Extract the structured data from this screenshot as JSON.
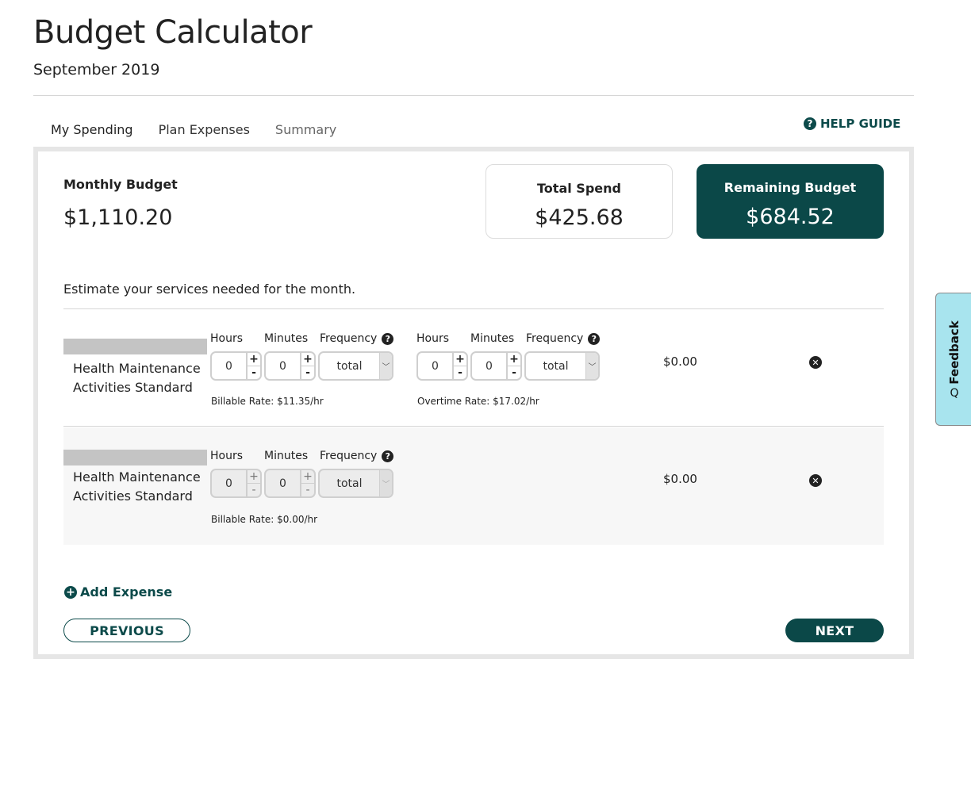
{
  "header": {
    "title": "Budget Calculator",
    "subtitle": "September 2019"
  },
  "tabs": [
    {
      "label": "My Spending",
      "active": false
    },
    {
      "label": "Plan Expenses",
      "active": true
    },
    {
      "label": "Summary",
      "active": false
    }
  ],
  "help_guide": {
    "label": "HELP GUIDE",
    "icon": "question-circle-icon"
  },
  "summary": {
    "monthly_budget": {
      "label": "Monthly Budget",
      "value": "$1,110.20"
    },
    "total_spend": {
      "label": "Total Spend",
      "value": "$425.68"
    },
    "remaining_budget": {
      "label": "Remaining Budget",
      "value": "$684.52"
    }
  },
  "intro_text": "Estimate your services needed for the month.",
  "field_labels": {
    "hours": "Hours",
    "minutes": "Minutes",
    "frequency": "Frequency",
    "plus": "+",
    "minus": "-",
    "help_glyph": "?",
    "remove_glyph": "✕",
    "caret_glyph": "﹀"
  },
  "expenses": [
    {
      "service_name": "Health Maintenance Activities Standard",
      "disabled": false,
      "regular": {
        "hours": "0",
        "minutes": "0",
        "frequency": "total",
        "rate_text": "Billable Rate: $11.35/hr"
      },
      "overtime": {
        "hours": "0",
        "minutes": "0",
        "frequency": "total",
        "rate_text": "Overtime Rate: $17.02/hr"
      },
      "amount": "$0.00"
    },
    {
      "service_name": "Health Maintenance Activities Standard",
      "disabled": true,
      "regular": {
        "hours": "0",
        "minutes": "0",
        "frequency": "total",
        "rate_text": "Billable Rate: $0.00/hr"
      },
      "amount": "$0.00"
    }
  ],
  "actions": {
    "add_expense": "Add Expense",
    "add_glyph": "+",
    "previous": "PREVIOUS",
    "next": "NEXT"
  },
  "feedback": {
    "label": "Feedback",
    "icon_glyph": "Q"
  },
  "colors": {
    "primary": "#0b4848",
    "tab_active": "#137a8a",
    "feedback_bg": "#a8e4ee",
    "panel_border": "#e6e6e6"
  }
}
